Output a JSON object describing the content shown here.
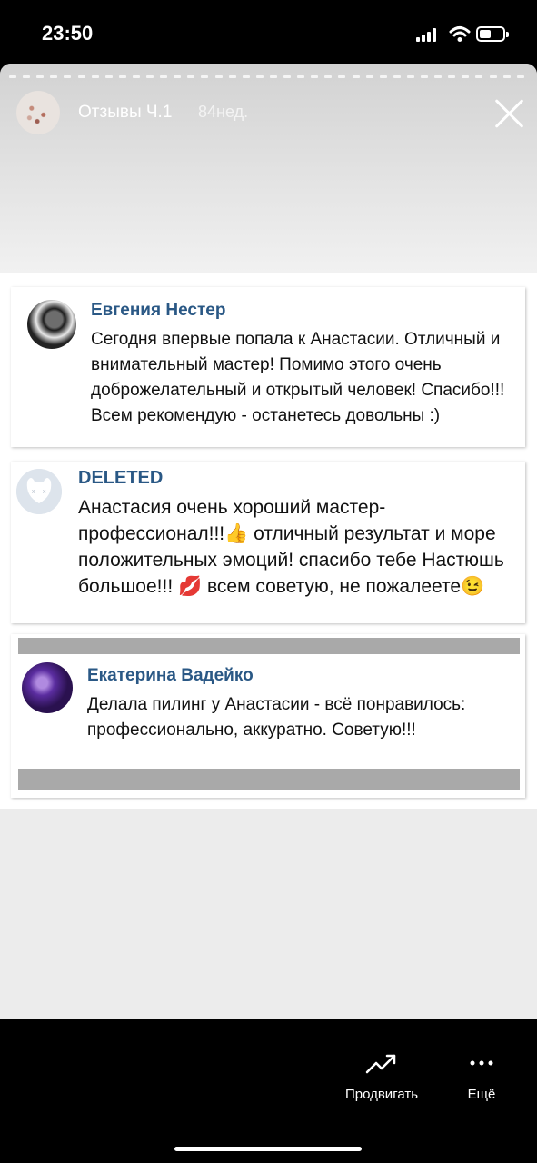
{
  "status_bar": {
    "time": "23:50"
  },
  "story": {
    "title": "Отзывы Ч.1",
    "age": "84нед."
  },
  "reviews": [
    {
      "author": "Евгения Нестер",
      "text": "Сегодня впервые попала к Анастасии. Отличный и внимательный мастер! Помимо этого очень доброжелательный и открытый человек! Спасибо!!! Всем рекомендую - останетесь довольны :)"
    },
    {
      "author": "DELETED",
      "text": "Анастасия очень хороший мастер-профессионал!!!👍 отличный результат и море положительных эмоций! спасибо тебе Настюшь большое!!! 💋 всем советую, не пожалеете😉"
    },
    {
      "author": "Екатерина Вадейко",
      "text": "Делала пилинг у Анастасии - всё понравилось: профессионально, аккуратно. Советую!!!"
    }
  ],
  "actions": {
    "promote_label": "Продвигать",
    "more_label": "Ещё"
  },
  "icons": {
    "promote": "trend-arrow-icon",
    "more": "more-dots-icon",
    "close": "close-icon"
  },
  "colors": {
    "author_name": "#2a5885",
    "background": "#000000",
    "story_bg": "#ececec"
  }
}
